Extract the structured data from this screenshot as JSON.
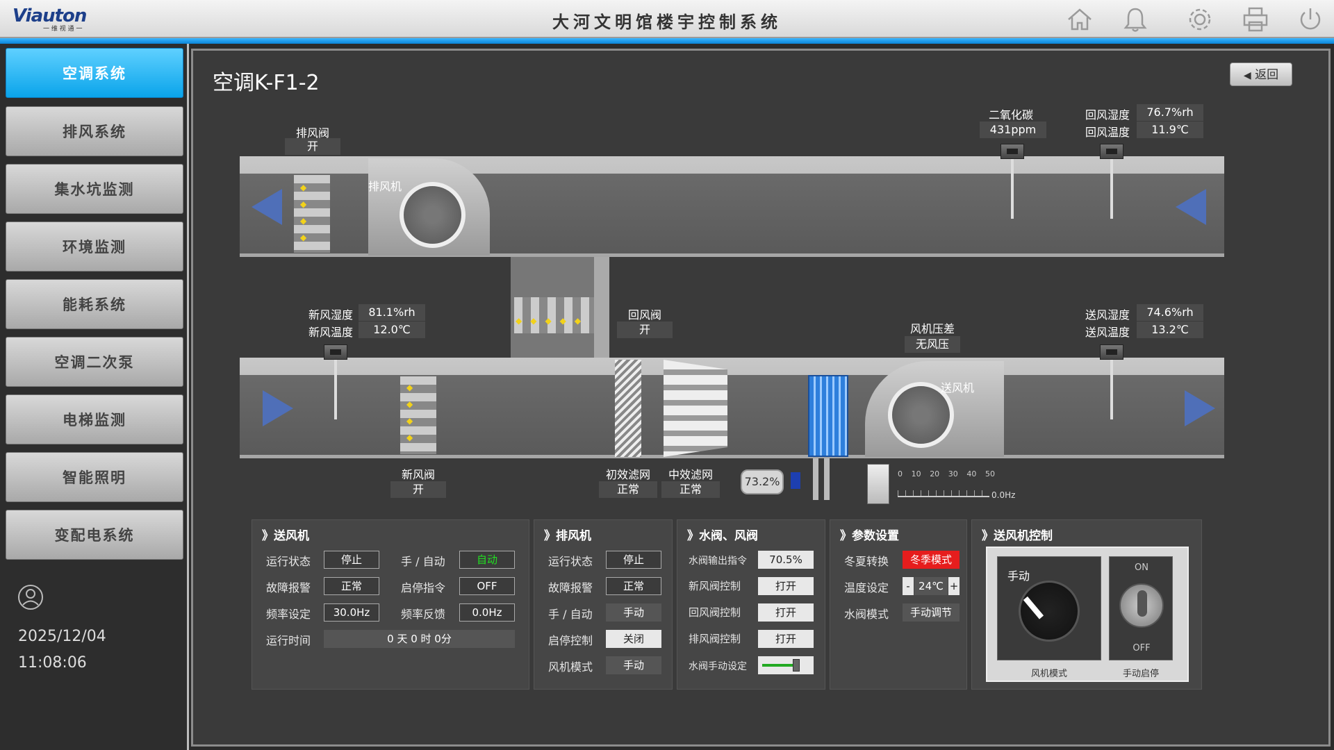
{
  "header": {
    "logo_text": "Viauton",
    "logo_sub": "一 维 视 通 一",
    "title": "大河文明馆楼宇控制系统"
  },
  "sidebar": {
    "items": [
      {
        "label": "空调系统"
      },
      {
        "label": "排风系统"
      },
      {
        "label": "集水坑监测"
      },
      {
        "label": "环境监测"
      },
      {
        "label": "能耗系统"
      },
      {
        "label": "空调二次泵"
      },
      {
        "label": "电梯监测"
      },
      {
        "label": "智能照明"
      },
      {
        "label": "变配电系统"
      }
    ],
    "active_index": 0,
    "date": "2025/12/04",
    "time": "11:08:06"
  },
  "main": {
    "title": "空调K-F1-2",
    "back_label": "返回"
  },
  "schematic": {
    "exhaust_damper": {
      "label": "排风阀",
      "value": "开"
    },
    "exhaust_fan_label": "排风机",
    "co2": {
      "label": "二氧化碳",
      "value": "431ppm"
    },
    "return_humidity": {
      "label": "回风湿度",
      "value": "76.7%rh"
    },
    "return_temp": {
      "label": "回风温度",
      "value": "11.9℃"
    },
    "fresh_humidity": {
      "label": "新风湿度",
      "value": "81.1%rh"
    },
    "fresh_temp": {
      "label": "新风温度",
      "value": "12.0℃"
    },
    "return_damper": {
      "label": "回风阀",
      "value": "开"
    },
    "fan_pressure": {
      "label": "风机压差",
      "value": "无风压"
    },
    "supply_humidity": {
      "label": "送风湿度",
      "value": "74.6%rh"
    },
    "supply_temp": {
      "label": "送风温度",
      "value": "13.2℃"
    },
    "supply_fan_label": "送风机",
    "fresh_damper": {
      "label": "新风阀",
      "value": "开"
    },
    "primary_filter": {
      "label": "初效滤网",
      "value": "正常"
    },
    "medium_filter": {
      "label": "中效滤网",
      "value": "正常"
    },
    "valve_opening": "73.2%",
    "vfd_scale": [
      "0",
      "10",
      "20",
      "30",
      "40",
      "50"
    ],
    "vfd_reading": "0.0Hz"
  },
  "panels": {
    "supply_fan": {
      "title": "》送风机",
      "run_state_label": "运行状态",
      "run_state": "停止",
      "mode_label": "手 / 自动",
      "mode": "自动",
      "fault_label": "故障报警",
      "fault": "正常",
      "start_cmd_label": "启停指令",
      "start_cmd": "OFF",
      "freq_set_label": "频率设定",
      "freq_set": "30.0Hz",
      "freq_fb_label": "频率反馈",
      "freq_fb": "0.0Hz",
      "runtime_label": "运行时间",
      "runtime": "0 天 0 时 0分"
    },
    "exhaust_fan": {
      "title": "》排风机",
      "run_state_label": "运行状态",
      "run_state": "停止",
      "fault_label": "故障报警",
      "fault": "正常",
      "mode_label": "手 / 自动",
      "mode": "手动",
      "start_ctrl_label": "启停控制",
      "start_ctrl": "关闭",
      "fan_mode_label": "风机模式",
      "fan_mode": "手动"
    },
    "valves": {
      "title": "》水阀、风阀",
      "water_cmd_label": "水阀输出指令",
      "water_cmd": "70.5%",
      "fresh_ctrl_label": "新风阀控制",
      "fresh_ctrl": "打开",
      "return_ctrl_label": "回风阀控制",
      "return_ctrl": "打开",
      "exhaust_ctrl_label": "排风阀控制",
      "exhaust_ctrl": "打开",
      "manual_set_label": "水阀手动设定",
      "manual_set_level": 0.72
    },
    "params": {
      "title": "》参数设置",
      "season_label": "冬夏转换",
      "season": "冬季模式",
      "temp_label": "温度设定",
      "temp": "24℃",
      "minus": "-",
      "plus": "+",
      "valve_mode_label": "水阀模式",
      "valve_mode": "手动调节"
    },
    "fan_control": {
      "title": "》送风机控制",
      "knob_label": "手动",
      "knob_caption": "风机模式",
      "switch_on": "ON",
      "switch_off": "OFF",
      "switch_caption": "手动启停"
    }
  },
  "colors": {
    "accent_blue": "#0aa4ea",
    "alarm_red": "#e61d1d",
    "auto_green": "#22e022"
  }
}
